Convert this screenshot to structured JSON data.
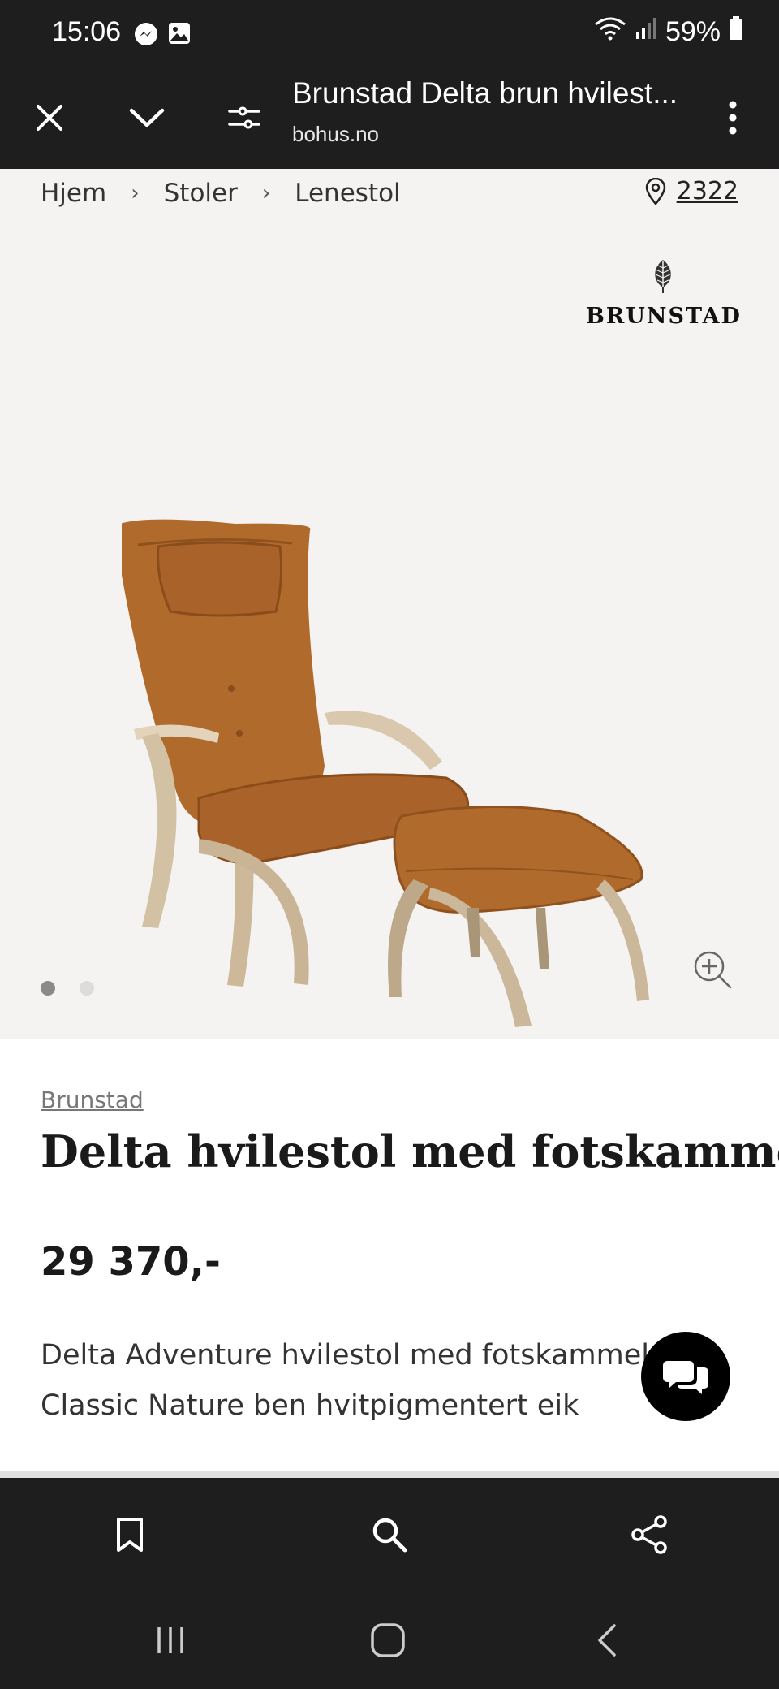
{
  "status_bar": {
    "time": "15:06",
    "battery": "59%",
    "icons": [
      "messenger-icon",
      "gallery-icon",
      "wifi-icon",
      "signal-icon",
      "battery-icon"
    ]
  },
  "browser": {
    "title": "Brunstad Delta brun hvilest...",
    "url": "bohus.no",
    "icons": [
      "close-icon",
      "chevron-down-icon",
      "tune-icon",
      "more-vert-icon"
    ]
  },
  "breadcrumb": {
    "items": [
      "Hjem",
      "Stoler",
      "Lenestol"
    ],
    "separator": "›"
  },
  "store": {
    "code": "2322"
  },
  "brand_logo": {
    "name": "BRUNSTAD"
  },
  "gallery": {
    "current": 1,
    "total": 2
  },
  "product": {
    "brand": "Brunstad",
    "title": "Delta hvilestol med fotskammel",
    "price": "29 370,-",
    "description": "Delta Adventure hvilestol med fotskammel Classic Nature ben hvitpigmentert eik"
  },
  "colors": {
    "leather": "#b06a2c",
    "wood": "#d9c8ad",
    "hero_bg": "#f5f3f1",
    "chrome": "#1e1e1e"
  },
  "bottom_bar": {
    "icons": [
      "bookmark-icon",
      "search-icon",
      "share-icon"
    ]
  },
  "nav_bar": {
    "icons": [
      "recent-apps-icon",
      "home-icon",
      "back-icon"
    ]
  }
}
